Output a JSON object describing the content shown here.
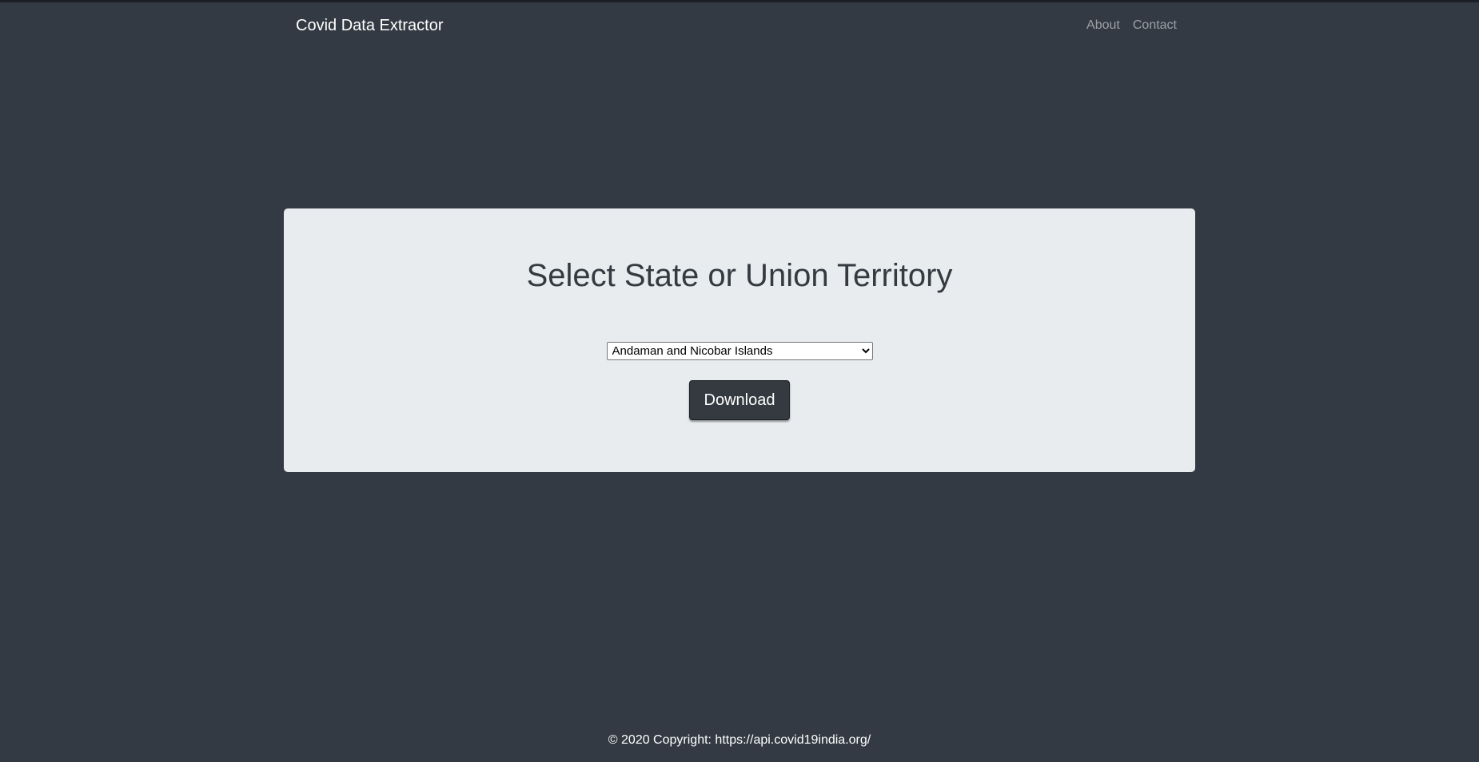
{
  "navbar": {
    "brand": "Covid Data Extractor",
    "links": [
      "About",
      "Contact"
    ]
  },
  "main": {
    "heading": "Select State or Union Territory",
    "select": {
      "selected": "Andaman and Nicobar Islands"
    },
    "download_label": "Download"
  },
  "footer": {
    "copyright": "© 2020 Copyright: https://api.covid19india.org/"
  },
  "colors": {
    "page_background": "#343a43",
    "panel_background": "#e8ecef",
    "button_background": "#343a40",
    "heading_text": "#343a40",
    "nav_link_text": "#9aa0a6"
  }
}
